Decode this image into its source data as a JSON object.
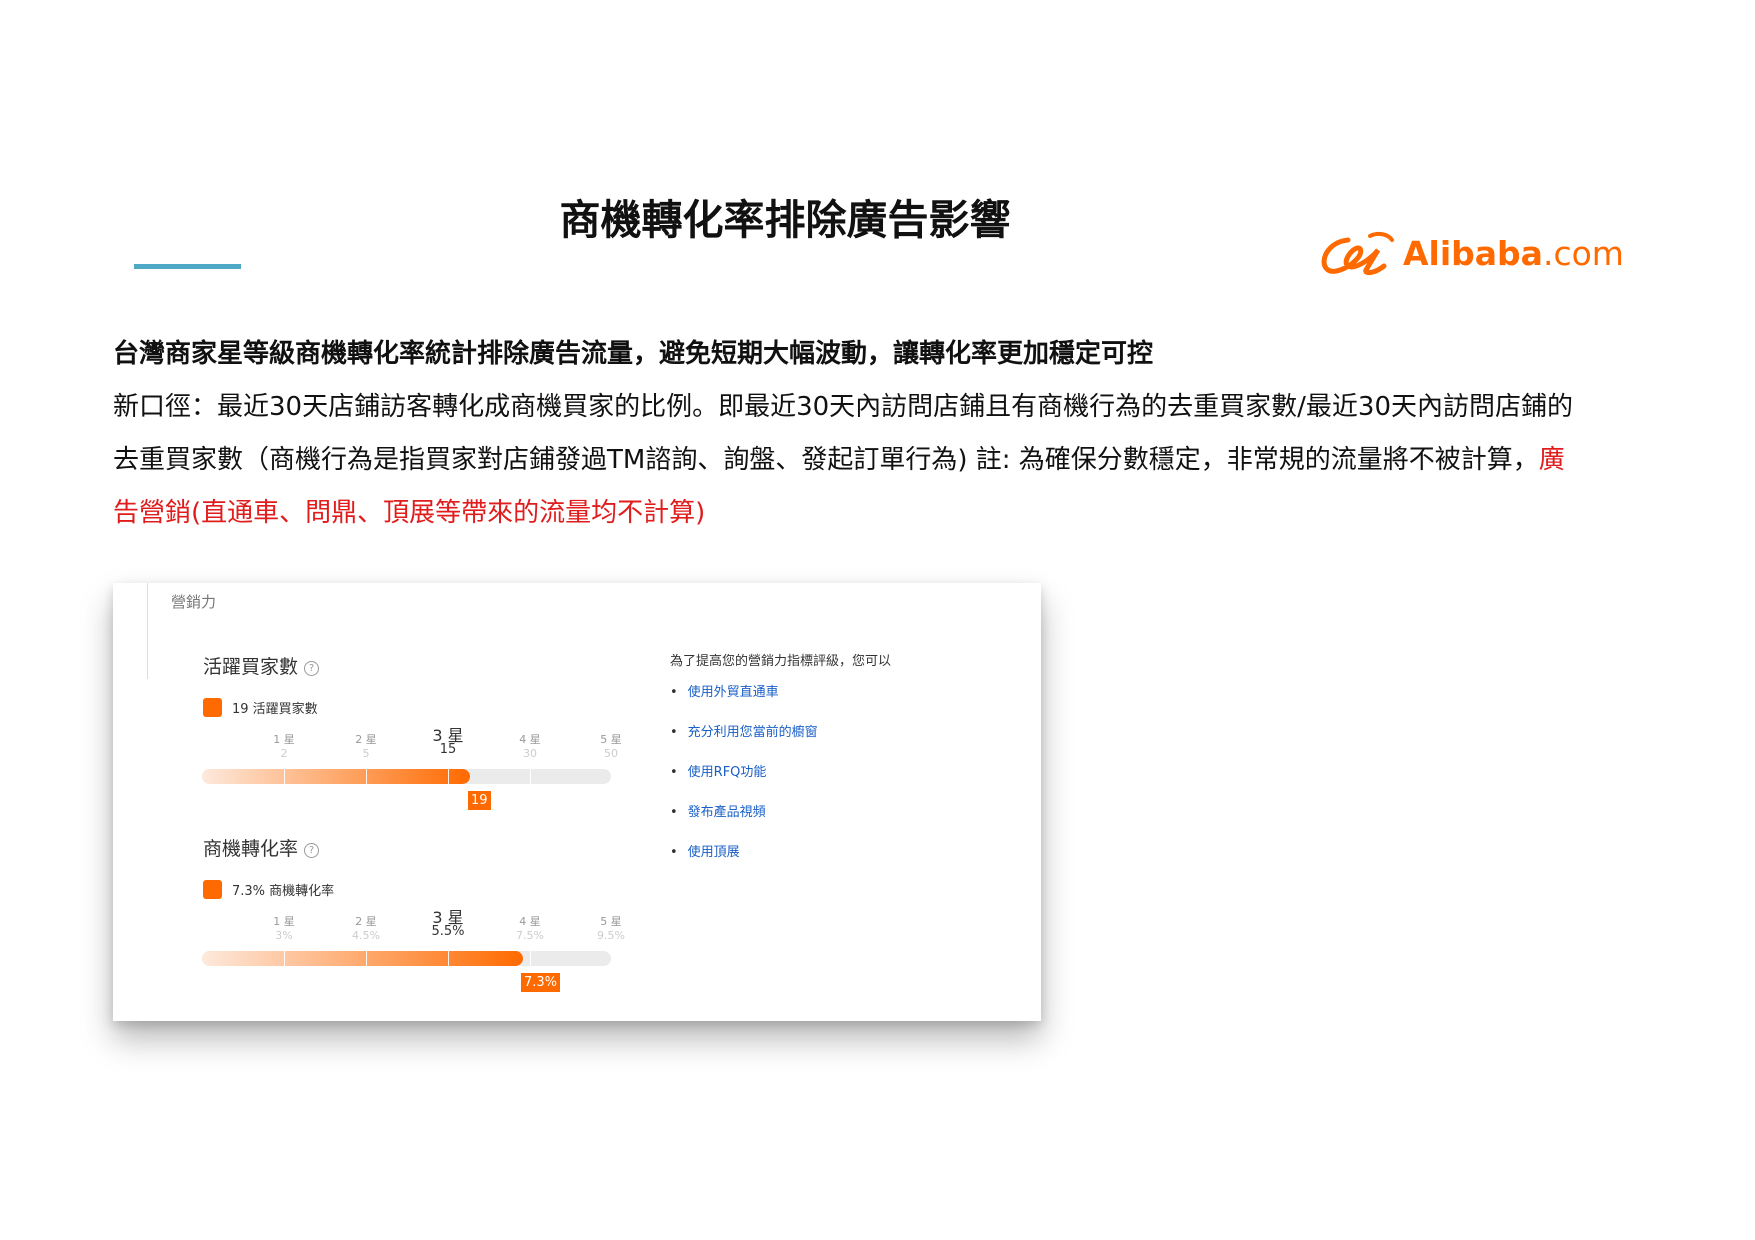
{
  "title": "商機轉化率排除廣告影響",
  "logo": {
    "text": "Alibaba",
    "suffix": ".com",
    "color": "#ff6a00"
  },
  "intro": {
    "lead": "台灣商家星等級商機轉化率統計排除廣告流量，避免短期大幅波動，讓轉化率更加穩定可控",
    "body": "新口徑：最近30天店鋪訪客轉化成商機買家的比例。即最近30天內訪問店鋪且有商機行為的去重買家數/最近30天內訪問店鋪的去重買家數（商機行為是指買家對店鋪發過TM諮詢、詢盤、發起訂單行為) 註: 為確保分數穩定，非常規的流量將不被計算，",
    "highlight": "廣告營銷(直通車、問鼎、頂展等帶來的流量均不計算)"
  },
  "screenshot": {
    "section_label": "營銷力",
    "metrics": [
      {
        "title": "活躍買家數",
        "legend": "19 活躍買家數",
        "ticks": [
          {
            "star": "1 星",
            "value": "2"
          },
          {
            "star": "2 星",
            "value": "5"
          },
          {
            "star": "3 星",
            "value": "15"
          },
          {
            "star": "4 星",
            "value": "30"
          },
          {
            "star": "5 星",
            "value": "50"
          }
        ],
        "current_tick": 2,
        "progress": 0.655,
        "marker": "19"
      },
      {
        "title": "商機轉化率",
        "legend": "7.3% 商機轉化率",
        "ticks": [
          {
            "star": "1 星",
            "value": "3%"
          },
          {
            "star": "2 星",
            "value": "4.5%"
          },
          {
            "star": "3 星",
            "value": "5.5%"
          },
          {
            "star": "4 星",
            "value": "7.5%"
          },
          {
            "star": "5 星",
            "value": "9.5%"
          }
        ],
        "current_tick": 2,
        "progress": 0.785,
        "marker": "7.3%"
      }
    ],
    "tips_heading": "為了提高您的營銷力指標評級，您可以",
    "tips": [
      "使用外貿直通車",
      "充分利用您當前的櫥窗",
      "使用RFQ功能",
      "發布產品視頻",
      "使用頂展"
    ]
  }
}
